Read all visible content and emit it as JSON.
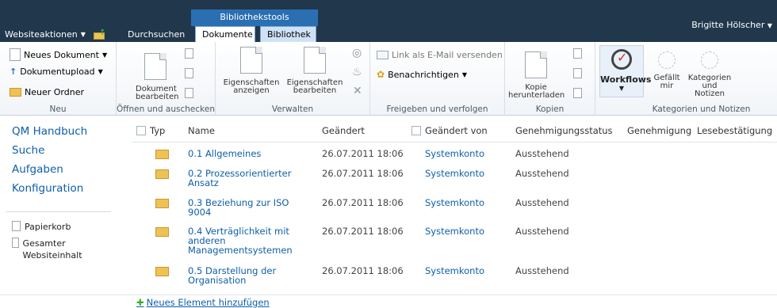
{
  "topbar": {
    "site_actions": "Websiteaktionen",
    "context_group": "Bibliothekstools",
    "tabs": [
      "Durchsuchen",
      "Dokumente",
      "Bibliothek"
    ],
    "user": "Brigitte Hölscher"
  },
  "ribbon": {
    "groups": [
      {
        "label": "Neu",
        "items": [
          "Neues Dokument",
          "Dokumentupload",
          "Neuer Ordner"
        ]
      },
      {
        "label": "Öffnen und auschecken",
        "items": [
          "Dokument bearbeiten"
        ]
      },
      {
        "label": "Verwalten",
        "items": [
          "Eigenschaften anzeigen",
          "Eigenschaften bearbeiten"
        ]
      },
      {
        "label": "Freigeben und verfolgen",
        "items": [
          "Link als E-Mail versenden",
          "Benachrichtigen"
        ]
      },
      {
        "label": "Kopien",
        "items": [
          "Kopie herunterladen"
        ]
      },
      {
        "label": "Workflows",
        "items": [
          "Workflows"
        ]
      },
      {
        "label": "Kategorien und Notizen",
        "items": [
          "Gefällt mir",
          "Kategorien und Notizen"
        ]
      }
    ]
  },
  "leftnav": {
    "items": [
      "QM Handbuch",
      "Suche",
      "Aufgaben",
      "Konfiguration"
    ],
    "recycle": "Papierkorb",
    "all_content": "Gesamter Websiteinhalt"
  },
  "list": {
    "columns": [
      "Typ",
      "Name",
      "Geändert",
      "Geändert von",
      "Genehmigungsstatus",
      "Genehmigung",
      "Lesebestätigung"
    ],
    "rows": [
      {
        "name": "0.1 Allgemeines",
        "modified": "26.07.2011 18:06",
        "modified_by": "Systemkonto",
        "status": "Ausstehend"
      },
      {
        "name": "0.2 Prozessorientierter Ansatz",
        "modified": "26.07.2011 18:06",
        "modified_by": "Systemkonto",
        "status": "Ausstehend"
      },
      {
        "name": "0.3 Beziehung zur ISO 9004",
        "modified": "26.07.2011 18:06",
        "modified_by": "Systemkonto",
        "status": "Ausstehend"
      },
      {
        "name": "0.4 Verträglichkeit mit anderen Managementsystemen",
        "modified": "26.07.2011 18:06",
        "modified_by": "Systemkonto",
        "status": "Ausstehend"
      },
      {
        "name": "0.5 Darstellung der Organisation",
        "modified": "26.07.2011 18:06",
        "modified_by": "Systemkonto",
        "status": "Ausstehend"
      }
    ],
    "add_new": "Neues Element hinzufügen"
  }
}
